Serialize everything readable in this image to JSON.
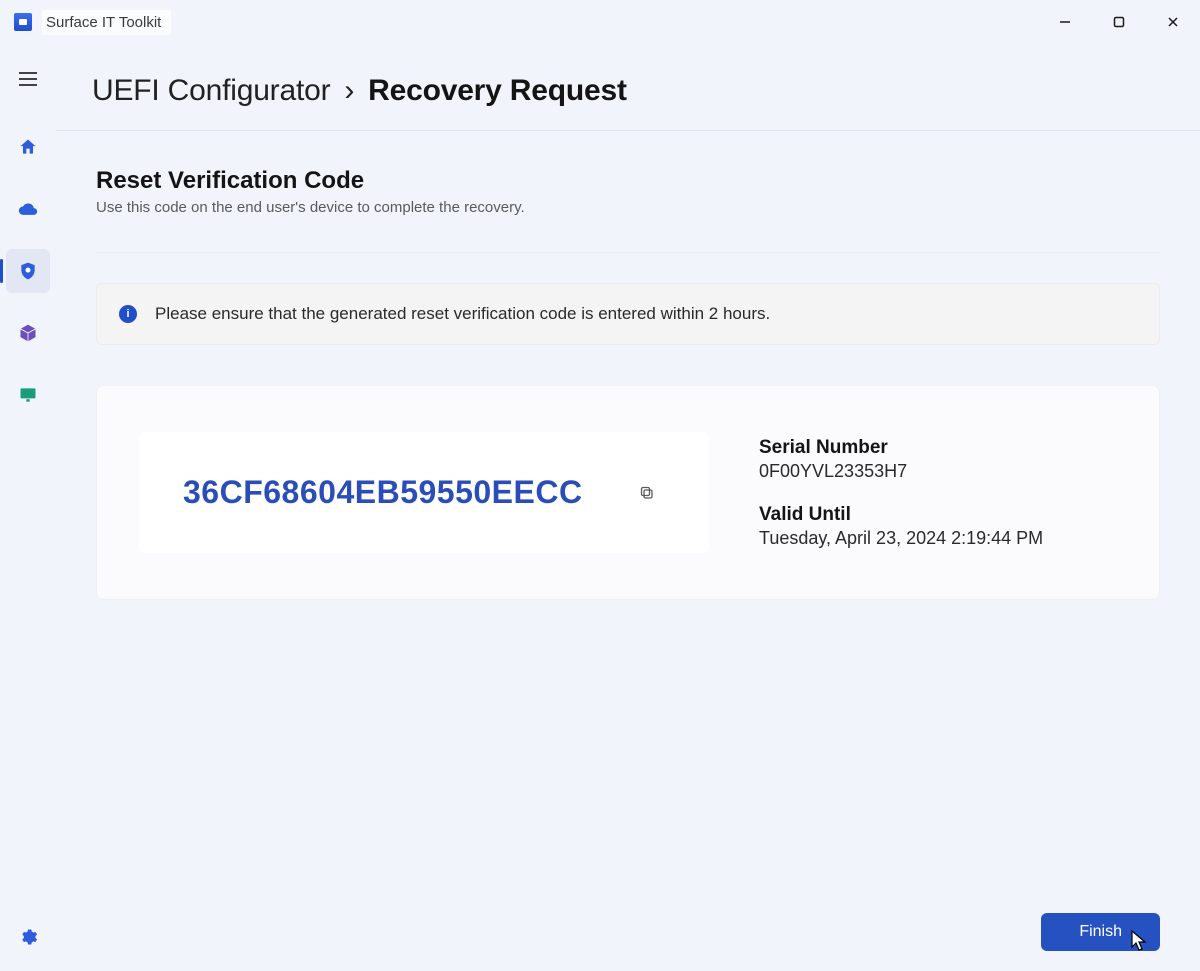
{
  "app": {
    "title": "Surface IT Toolkit"
  },
  "breadcrumb": {
    "root": "UEFI Configurator",
    "sep": "›",
    "current": "Recovery Request"
  },
  "section": {
    "title": "Reset Verification Code",
    "subtitle": "Use this code on the end user's device to complete the recovery."
  },
  "info": {
    "message": "Please ensure that the generated reset verification code is entered within 2 hours."
  },
  "code": {
    "value": "36CF68604EB59550EECC",
    "serial_label": "Serial Number",
    "serial_value": "0F00YVL23353H7",
    "valid_label": "Valid Until",
    "valid_value": "Tuesday, April 23, 2024 2:19:44 PM"
  },
  "footer": {
    "finish": "Finish"
  },
  "icons": {
    "home": "home",
    "cloud": "cloud",
    "shield": "shield",
    "box": "box",
    "display": "display",
    "settings": "gear"
  }
}
